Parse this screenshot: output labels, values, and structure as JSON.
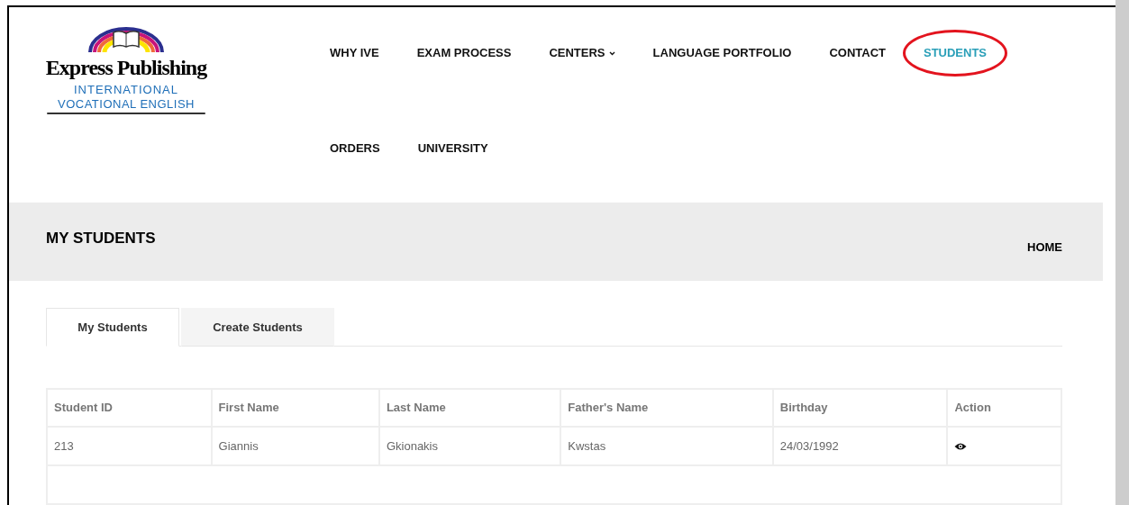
{
  "logo": {
    "title": "Express Publishing",
    "line_1": "INTERNATIONAL",
    "line_2": "VOCATIONAL ENGLISH"
  },
  "nav": [
    {
      "label": "WHY IVE",
      "selected": false,
      "dropdown": false,
      "circled": false
    },
    {
      "label": "EXAM PROCESS",
      "selected": false,
      "dropdown": false,
      "circled": false
    },
    {
      "label": "CENTERS",
      "selected": false,
      "dropdown": true,
      "circled": false
    },
    {
      "label": "LANGUAGE PORTFOLIO",
      "selected": false,
      "dropdown": false,
      "circled": false
    },
    {
      "label": "CONTACT",
      "selected": false,
      "dropdown": false,
      "circled": false
    },
    {
      "label": "STUDENTS",
      "selected": true,
      "dropdown": false,
      "circled": true
    },
    {
      "label": "ORDERS",
      "selected": false,
      "dropdown": false,
      "circled": false
    },
    {
      "label": "UNIVERSITY",
      "selected": false,
      "dropdown": false,
      "circled": false
    }
  ],
  "page_title": "MY STUDENTS",
  "breadcrumb": "HOME",
  "tabs": [
    {
      "label": "My Students",
      "selected": true
    },
    {
      "label": "Create Students",
      "selected": false
    }
  ],
  "table": {
    "columns": [
      "Student ID",
      "First Name",
      "Last Name",
      "Father's Name",
      "Birthday",
      "Action"
    ],
    "rows": [
      {
        "cells": [
          "213",
          "Giannis",
          "Gkionakis",
          "Kwstas",
          "24/03/1992"
        ]
      }
    ]
  }
}
